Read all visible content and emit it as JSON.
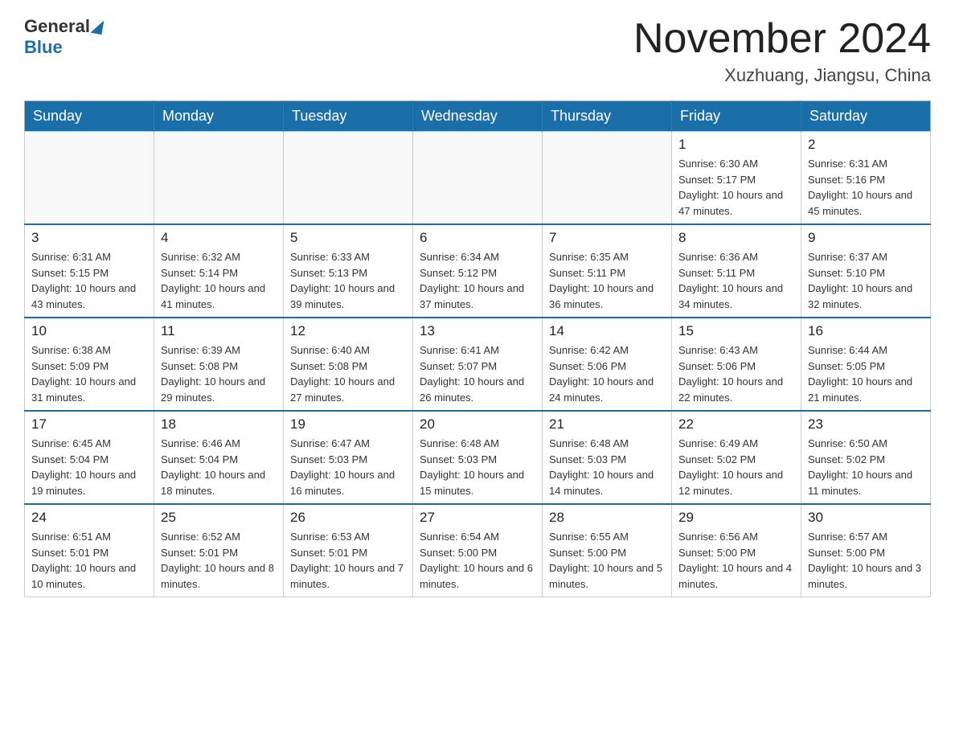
{
  "header": {
    "logo_general": "General",
    "logo_blue": "Blue",
    "month_title": "November 2024",
    "location": "Xuzhuang, Jiangsu, China"
  },
  "weekdays": [
    "Sunday",
    "Monday",
    "Tuesday",
    "Wednesday",
    "Thursday",
    "Friday",
    "Saturday"
  ],
  "weeks": [
    [
      {
        "day": "",
        "info": ""
      },
      {
        "day": "",
        "info": ""
      },
      {
        "day": "",
        "info": ""
      },
      {
        "day": "",
        "info": ""
      },
      {
        "day": "",
        "info": ""
      },
      {
        "day": "1",
        "info": "Sunrise: 6:30 AM\nSunset: 5:17 PM\nDaylight: 10 hours and 47 minutes."
      },
      {
        "day": "2",
        "info": "Sunrise: 6:31 AM\nSunset: 5:16 PM\nDaylight: 10 hours and 45 minutes."
      }
    ],
    [
      {
        "day": "3",
        "info": "Sunrise: 6:31 AM\nSunset: 5:15 PM\nDaylight: 10 hours and 43 minutes."
      },
      {
        "day": "4",
        "info": "Sunrise: 6:32 AM\nSunset: 5:14 PM\nDaylight: 10 hours and 41 minutes."
      },
      {
        "day": "5",
        "info": "Sunrise: 6:33 AM\nSunset: 5:13 PM\nDaylight: 10 hours and 39 minutes."
      },
      {
        "day": "6",
        "info": "Sunrise: 6:34 AM\nSunset: 5:12 PM\nDaylight: 10 hours and 37 minutes."
      },
      {
        "day": "7",
        "info": "Sunrise: 6:35 AM\nSunset: 5:11 PM\nDaylight: 10 hours and 36 minutes."
      },
      {
        "day": "8",
        "info": "Sunrise: 6:36 AM\nSunset: 5:11 PM\nDaylight: 10 hours and 34 minutes."
      },
      {
        "day": "9",
        "info": "Sunrise: 6:37 AM\nSunset: 5:10 PM\nDaylight: 10 hours and 32 minutes."
      }
    ],
    [
      {
        "day": "10",
        "info": "Sunrise: 6:38 AM\nSunset: 5:09 PM\nDaylight: 10 hours and 31 minutes."
      },
      {
        "day": "11",
        "info": "Sunrise: 6:39 AM\nSunset: 5:08 PM\nDaylight: 10 hours and 29 minutes."
      },
      {
        "day": "12",
        "info": "Sunrise: 6:40 AM\nSunset: 5:08 PM\nDaylight: 10 hours and 27 minutes."
      },
      {
        "day": "13",
        "info": "Sunrise: 6:41 AM\nSunset: 5:07 PM\nDaylight: 10 hours and 26 minutes."
      },
      {
        "day": "14",
        "info": "Sunrise: 6:42 AM\nSunset: 5:06 PM\nDaylight: 10 hours and 24 minutes."
      },
      {
        "day": "15",
        "info": "Sunrise: 6:43 AM\nSunset: 5:06 PM\nDaylight: 10 hours and 22 minutes."
      },
      {
        "day": "16",
        "info": "Sunrise: 6:44 AM\nSunset: 5:05 PM\nDaylight: 10 hours and 21 minutes."
      }
    ],
    [
      {
        "day": "17",
        "info": "Sunrise: 6:45 AM\nSunset: 5:04 PM\nDaylight: 10 hours and 19 minutes."
      },
      {
        "day": "18",
        "info": "Sunrise: 6:46 AM\nSunset: 5:04 PM\nDaylight: 10 hours and 18 minutes."
      },
      {
        "day": "19",
        "info": "Sunrise: 6:47 AM\nSunset: 5:03 PM\nDaylight: 10 hours and 16 minutes."
      },
      {
        "day": "20",
        "info": "Sunrise: 6:48 AM\nSunset: 5:03 PM\nDaylight: 10 hours and 15 minutes."
      },
      {
        "day": "21",
        "info": "Sunrise: 6:48 AM\nSunset: 5:03 PM\nDaylight: 10 hours and 14 minutes."
      },
      {
        "day": "22",
        "info": "Sunrise: 6:49 AM\nSunset: 5:02 PM\nDaylight: 10 hours and 12 minutes."
      },
      {
        "day": "23",
        "info": "Sunrise: 6:50 AM\nSunset: 5:02 PM\nDaylight: 10 hours and 11 minutes."
      }
    ],
    [
      {
        "day": "24",
        "info": "Sunrise: 6:51 AM\nSunset: 5:01 PM\nDaylight: 10 hours and 10 minutes."
      },
      {
        "day": "25",
        "info": "Sunrise: 6:52 AM\nSunset: 5:01 PM\nDaylight: 10 hours and 8 minutes."
      },
      {
        "day": "26",
        "info": "Sunrise: 6:53 AM\nSunset: 5:01 PM\nDaylight: 10 hours and 7 minutes."
      },
      {
        "day": "27",
        "info": "Sunrise: 6:54 AM\nSunset: 5:00 PM\nDaylight: 10 hours and 6 minutes."
      },
      {
        "day": "28",
        "info": "Sunrise: 6:55 AM\nSunset: 5:00 PM\nDaylight: 10 hours and 5 minutes."
      },
      {
        "day": "29",
        "info": "Sunrise: 6:56 AM\nSunset: 5:00 PM\nDaylight: 10 hours and 4 minutes."
      },
      {
        "day": "30",
        "info": "Sunrise: 6:57 AM\nSunset: 5:00 PM\nDaylight: 10 hours and 3 minutes."
      }
    ]
  ]
}
